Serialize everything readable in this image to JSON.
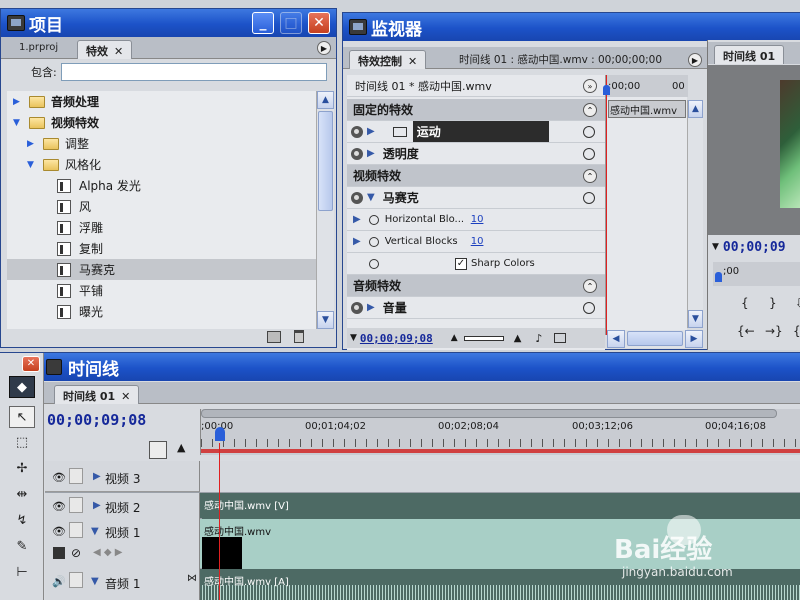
{
  "project_panel": {
    "title": "项目",
    "tabs": [
      {
        "label": "1.prproj"
      },
      {
        "label": "特效"
      }
    ],
    "search_label": "包含:",
    "search_value": "",
    "tree": [
      {
        "label": "音频处理",
        "bold": true
      },
      {
        "label": "视频特效",
        "bold": true
      },
      {
        "label": "调整"
      },
      {
        "label": "风格化"
      },
      {
        "label": "Alpha 发光"
      },
      {
        "label": "风"
      },
      {
        "label": "浮雕"
      },
      {
        "label": "复制"
      },
      {
        "label": "马赛克"
      },
      {
        "label": "平铺"
      },
      {
        "label": "曝光"
      }
    ]
  },
  "monitor_panel": {
    "title": "监视器",
    "tabs": [
      {
        "label": "特效控制"
      },
      {
        "label": "时间线 01 : 感动中国.wmv : 00;00;00;00"
      }
    ],
    "clip_header": "时间线 01 * 感动中国.wmv",
    "fixed_effects_header": "固定的特效",
    "motion_label": "运动",
    "opacity_label": "透明度",
    "video_effects_header": "视频特效",
    "mosaic_label": "马赛克",
    "horizontal_blocks_label": "Horizontal Blo...",
    "horizontal_blocks_value": "10",
    "vertical_blocks_label": "Vertical Blocks",
    "vertical_blocks_value": "10",
    "sharp_colors_label": "Sharp Colors",
    "audio_effects_header": "音频特效",
    "volume_label": "音量",
    "mini_time": ";00;00",
    "mini_time_end": "00",
    "mini_clip": "感动中国.wmv",
    "current_time": "00;00;09;08"
  },
  "program_monitor": {
    "tab": "时间线 01",
    "timecode": "00;00;09",
    "mini_time": ";00"
  },
  "timeline_panel": {
    "title": "时间线",
    "tab": "时间线 01",
    "timecode": "00;00;09;08",
    "ruler": ";00;00",
    "ruler_labels": [
      "00;01;04;02",
      "00;02;08;04",
      "00;03;12;06",
      "00;04;16;08"
    ],
    "tracks": [
      {
        "name": "视频 3",
        "clip": ""
      },
      {
        "name": "视频 2",
        "clip": "感动中国.wmv [V]"
      },
      {
        "name": "视频 1",
        "clip": "感动中国.wmv"
      },
      {
        "name": "音频 1",
        "clip": "感动中国.wmv [A]"
      }
    ]
  },
  "watermark": {
    "brand": "Bai经验",
    "url": "jingyan.baidu.com"
  },
  "colors": {
    "title_bar": "#1c52c8",
    "playhead": "#e02020",
    "video2_clip": "#4d6a64",
    "video1_clip": "#a8cfc6",
    "audio_clip": "#4d6a64"
  }
}
